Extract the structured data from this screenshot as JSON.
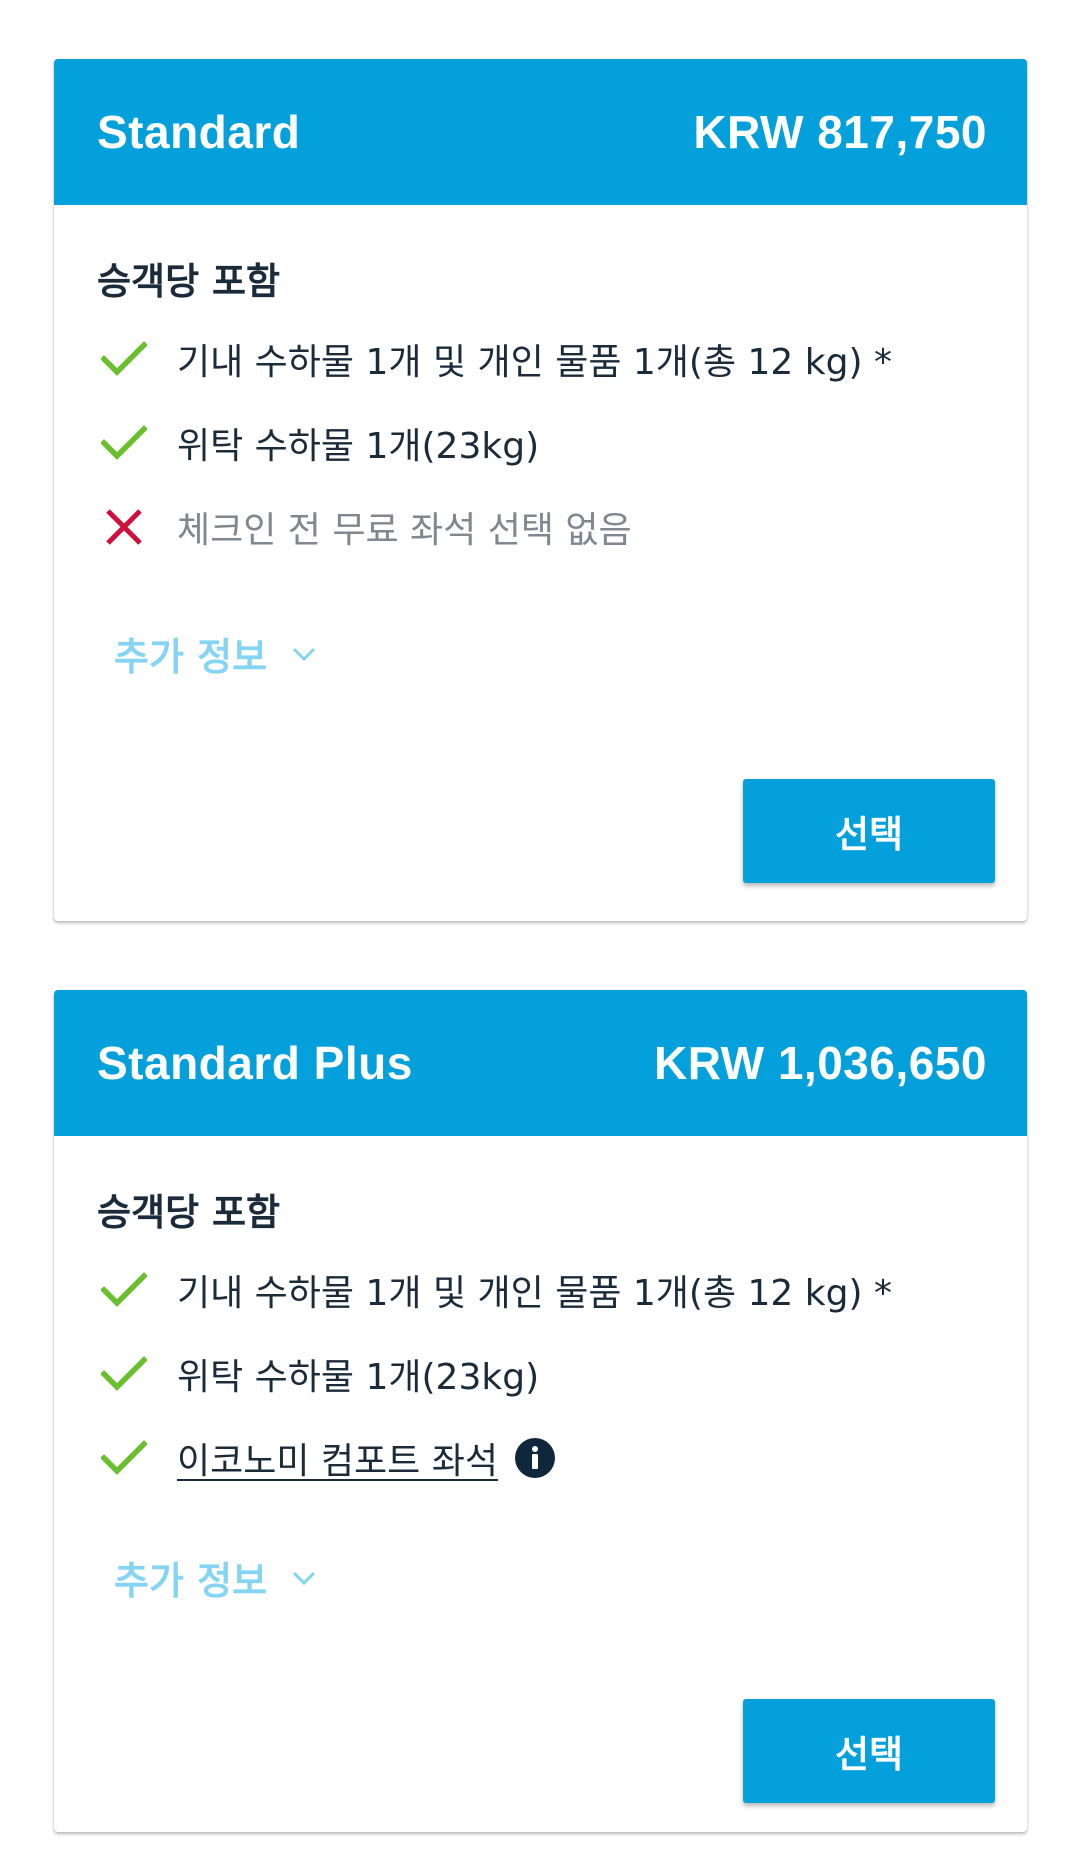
{
  "fares": [
    {
      "name": "Standard",
      "price": "KRW 817,750",
      "included_title": "승객당 포함",
      "features": [
        {
          "text": "기내 수하물 1개 및 개인 물품 1개(총 12 kg) *",
          "included": true,
          "icon": "check-icon"
        },
        {
          "text": "위탁 수하물 1개(23kg)",
          "included": true,
          "icon": "check-icon"
        },
        {
          "text": "체크인 전 무료 좌석 선택 없음",
          "included": false,
          "icon": "x-icon"
        }
      ],
      "more_info_label": "추가 정보",
      "select_label": "선택"
    },
    {
      "name": "Standard Plus",
      "price": "KRW 1,036,650",
      "included_title": "승객당 포함",
      "features": [
        {
          "text": "기내 수하물 1개 및 개인 물품 1개(총 12 kg) *",
          "included": true,
          "icon": "check-icon"
        },
        {
          "text": "위탁 수하물 1개(23kg)",
          "included": true,
          "icon": "check-icon"
        },
        {
          "text": "이코노미 컴포트 좌석",
          "included": true,
          "icon": "check-icon",
          "link": true,
          "info_icon": "info-icon"
        }
      ],
      "more_info_label": "추가 정보",
      "select_label": "선택"
    }
  ],
  "colors": {
    "brand_blue": "#03a0dc",
    "check_green": "#6abf2e",
    "cross_red": "#d0103a",
    "link_light_blue": "#86d4f4",
    "text_dark": "#1b2b3a",
    "text_muted": "#7f8790"
  }
}
